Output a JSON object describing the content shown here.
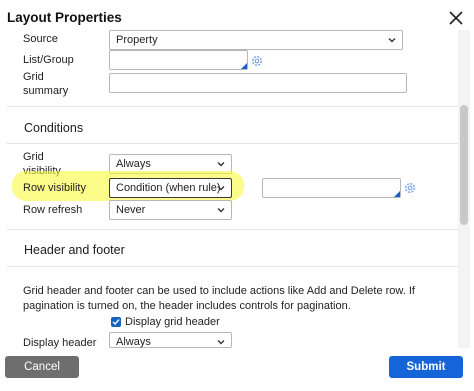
{
  "dialog": {
    "title": "Layout Properties",
    "close_icon": "close-icon"
  },
  "source": {
    "label": "Source",
    "value": "Property"
  },
  "list_group": {
    "label": "List/Group",
    "value": ""
  },
  "grid_summary": {
    "label_line1": "Grid",
    "label_line2": "summary",
    "value": ""
  },
  "conditions": {
    "heading": "Conditions",
    "grid_visibility": {
      "label_line1": "Grid",
      "label_line2": "visibility",
      "value": "Always"
    },
    "row_visibility": {
      "label": "Row visibility",
      "value": "Condition (when rule)",
      "rule_value": ""
    },
    "row_refresh": {
      "label": "Row refresh",
      "value": "Never"
    }
  },
  "header_footer": {
    "heading": "Header and footer",
    "help_text": "Grid header and footer can be used to include actions like Add and Delete row. If pagination is turned on, the header includes controls for pagination.",
    "display_grid_header": {
      "label": "Display grid header",
      "checked": true
    },
    "display_header": {
      "label": "Display header",
      "value": "Always"
    }
  },
  "buttons": {
    "cancel": "Cancel",
    "submit": "Submit"
  },
  "colors": {
    "accent": "#1565d8",
    "highlight": "#fafa3c",
    "cancel_bg": "#6e6e6e"
  }
}
